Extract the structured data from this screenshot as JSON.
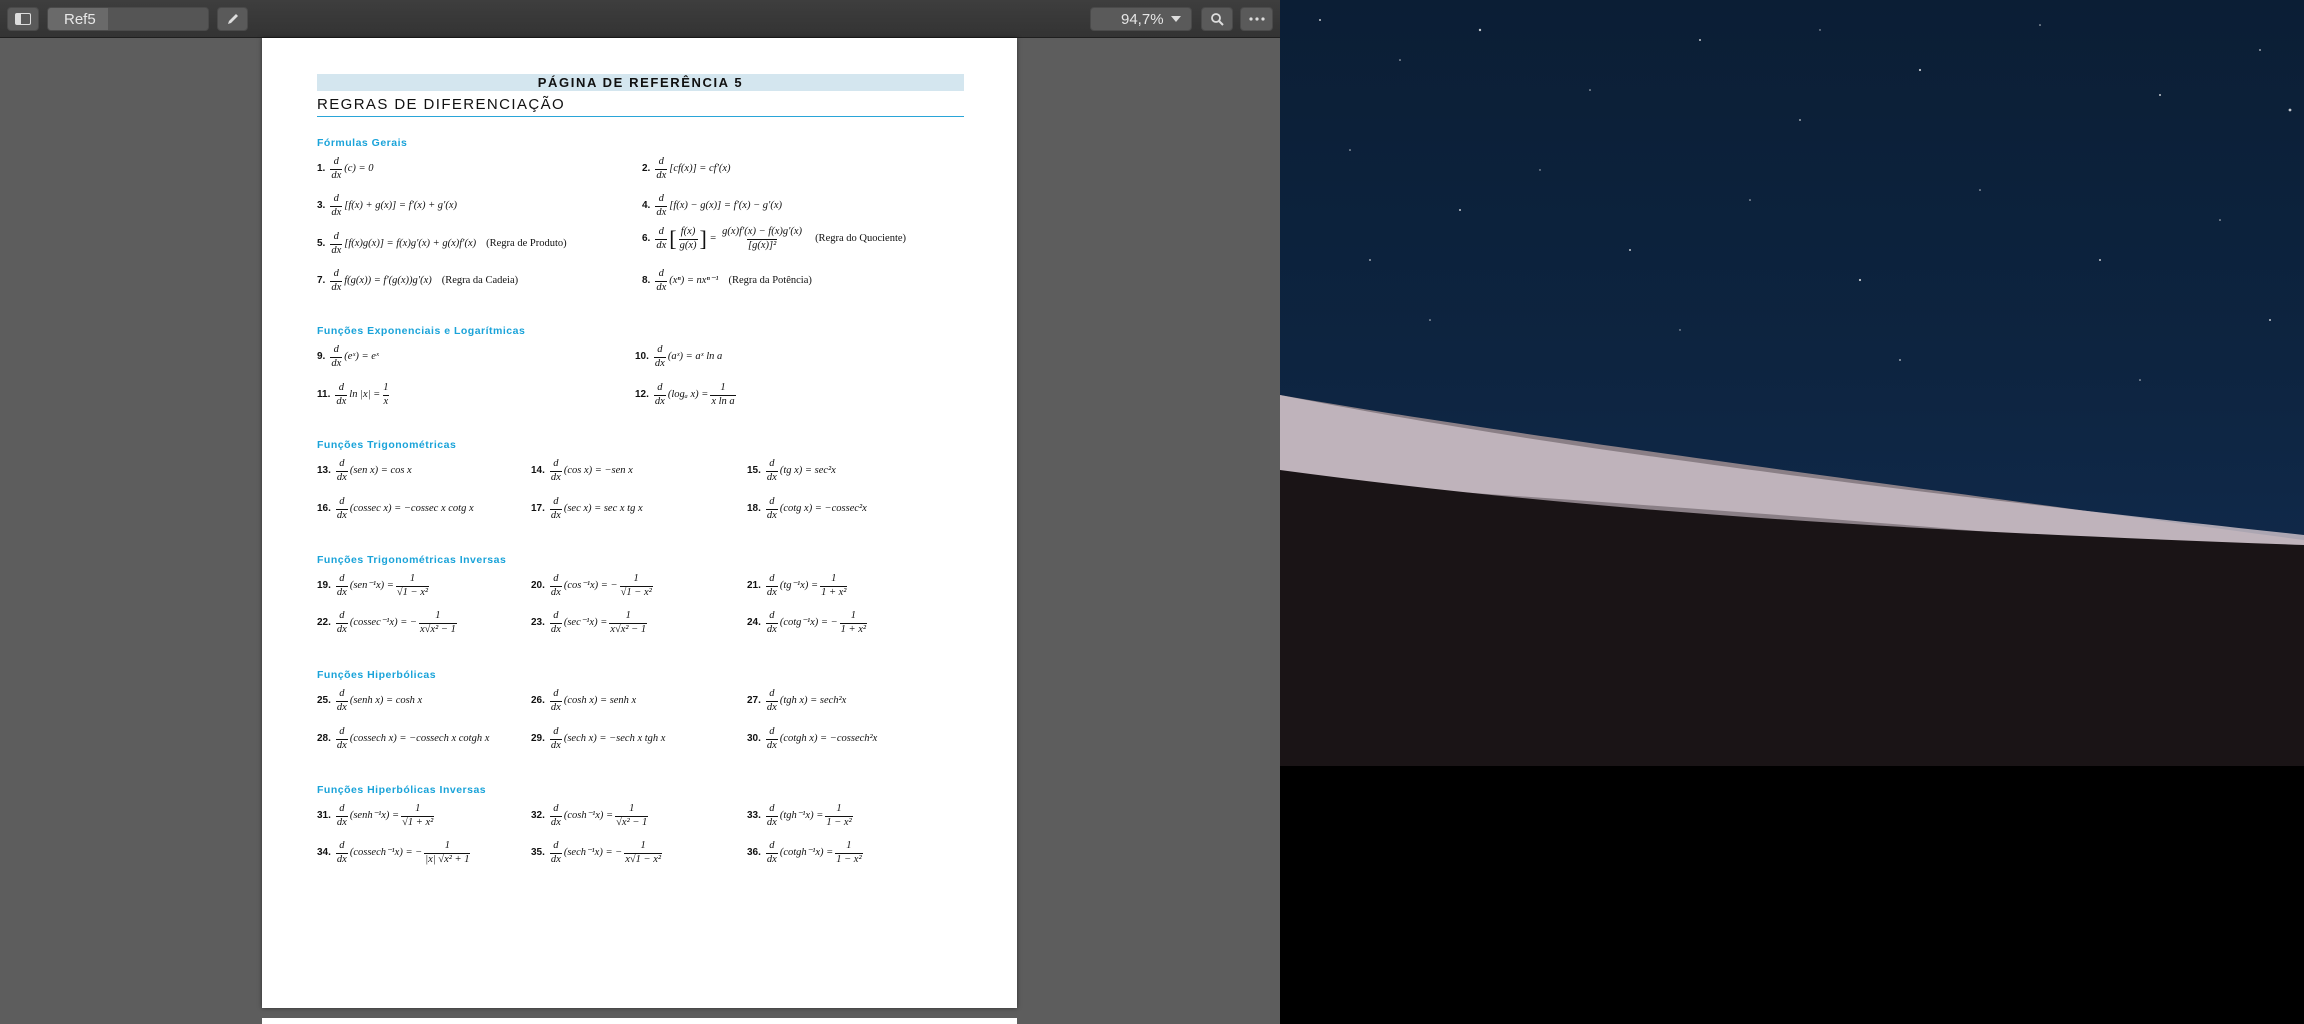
{
  "window": {
    "tab_name": "Ref5",
    "zoom": "94,7%",
    "icons": {
      "sidebar": "sidebar-icon",
      "edit": "pencil-icon",
      "search": "magnifier-icon",
      "more": "more-icon"
    }
  },
  "page": {
    "title": "PÁGINA DE REFERÊNCIA 5",
    "section": "REGRAS DE DIFERENCIAÇÃO",
    "groups": [
      {
        "title": "Fórmulas Gerais",
        "items": [
          {
            "n": "1.",
            "expr": "(c) = 0"
          },
          {
            "n": "2.",
            "expr": "[cf(x)] = cf′(x)"
          },
          {
            "n": "3.",
            "expr": "[f(x) + g(x)] = f′(x) + g′(x)"
          },
          {
            "n": "4.",
            "expr": "[f(x) − g(x)] = f′(x) − g′(x)"
          },
          {
            "n": "5.",
            "expr": "[f(x)g(x)] = f(x)g′(x) + g(x)f′(x)",
            "note": "(Regra de Produto)"
          },
          {
            "n": "6.",
            "expr_a": "f(x)",
            "expr_b": "g(x)",
            "expr_c": "g(x)f′(x) − f(x)g′(x)",
            "expr_d": "[g(x)]²",
            "note": "(Regra do Quociente)"
          },
          {
            "n": "7.",
            "expr": "f(g(x)) = f′(g(x))g′(x)",
            "note": "(Regra da Cadeia)"
          },
          {
            "n": "8.",
            "expr": "(xⁿ) = nxⁿ⁻¹",
            "note": "(Regra da Potência)"
          }
        ]
      },
      {
        "title": "Funções Exponenciais e Logarítmicas",
        "items": [
          {
            "n": "9.",
            "expr": "(eˣ) = eˣ"
          },
          {
            "n": "10.",
            "expr": "(aˣ) = aˣ ln a"
          },
          {
            "n": "11.",
            "expr": "ln |x| =",
            "top": "1",
            "bot": "x"
          },
          {
            "n": "12.",
            "expr": "(logₐ x) =",
            "top": "1",
            "bot": "x ln a"
          }
        ]
      },
      {
        "title": "Funções Trigonométricas",
        "items": [
          {
            "n": "13.",
            "expr": "(sen x) = cos x"
          },
          {
            "n": "14.",
            "expr": "(cos x) = −sen x"
          },
          {
            "n": "15.",
            "expr": "(tg x) = sec²x"
          },
          {
            "n": "16.",
            "expr": "(cossec x) = −cossec x cotg x"
          },
          {
            "n": "17.",
            "expr": "(sec x) = sec x tg x"
          },
          {
            "n": "18.",
            "expr": "(cotg x) = −cossec²x"
          }
        ]
      },
      {
        "title": "Funções Trigonométricas Inversas",
        "items": [
          {
            "n": "19.",
            "expr": "(sen⁻¹x) =",
            "top": "1",
            "bot": "√1 − x²"
          },
          {
            "n": "20.",
            "expr": "(cos⁻¹x) = −",
            "top": "1",
            "bot": "√1 − x²"
          },
          {
            "n": "21.",
            "expr": "(tg⁻¹x) =",
            "top": "1",
            "bot": "1 + x²"
          },
          {
            "n": "22.",
            "expr": "(cossec⁻¹x) = −",
            "top": "1",
            "bot": "x√x² − 1"
          },
          {
            "n": "23.",
            "expr": "(sec⁻¹x) =",
            "top": "1",
            "bot": "x√x² − 1"
          },
          {
            "n": "24.",
            "expr": "(cotg⁻¹x) = −",
            "top": "1",
            "bot": "1 + x²"
          }
        ]
      },
      {
        "title": "Funções Hiperbólicas",
        "items": [
          {
            "n": "25.",
            "expr": "(senh x) = cosh x"
          },
          {
            "n": "26.",
            "expr": "(cosh x) = senh x"
          },
          {
            "n": "27.",
            "expr": "(tgh x) = sech²x"
          },
          {
            "n": "28.",
            "expr": "(cossech x) = −cossech x cotgh x"
          },
          {
            "n": "29.",
            "expr": "(sech x) = −sech x tgh x"
          },
          {
            "n": "30.",
            "expr": "(cotgh x) = −cossech²x"
          }
        ]
      },
      {
        "title": "Funções Hiperbólicas Inversas",
        "items": [
          {
            "n": "31.",
            "expr": "(senh⁻¹x) =",
            "top": "1",
            "bot": "√1 + x²"
          },
          {
            "n": "32.",
            "expr": "(cosh⁻¹x) =",
            "top": "1",
            "bot": "√x² − 1"
          },
          {
            "n": "33.",
            "expr": "(tgh⁻¹x) =",
            "top": "1",
            "bot": "1 − x²"
          },
          {
            "n": "34.",
            "expr": "(cossech⁻¹x) = −",
            "top": "1",
            "bot": "|x| √x² + 1"
          },
          {
            "n": "35.",
            "expr": "(sech⁻¹x) = −",
            "top": "1",
            "bot": "x√1 − x²"
          },
          {
            "n": "36.",
            "expr": "(cotgh⁻¹x) =",
            "top": "1",
            "bot": "1 − x²"
          }
        ]
      }
    ]
  },
  "colors": {
    "accent": "#1aa3d9",
    "title_band": "#d4e6ef"
  }
}
